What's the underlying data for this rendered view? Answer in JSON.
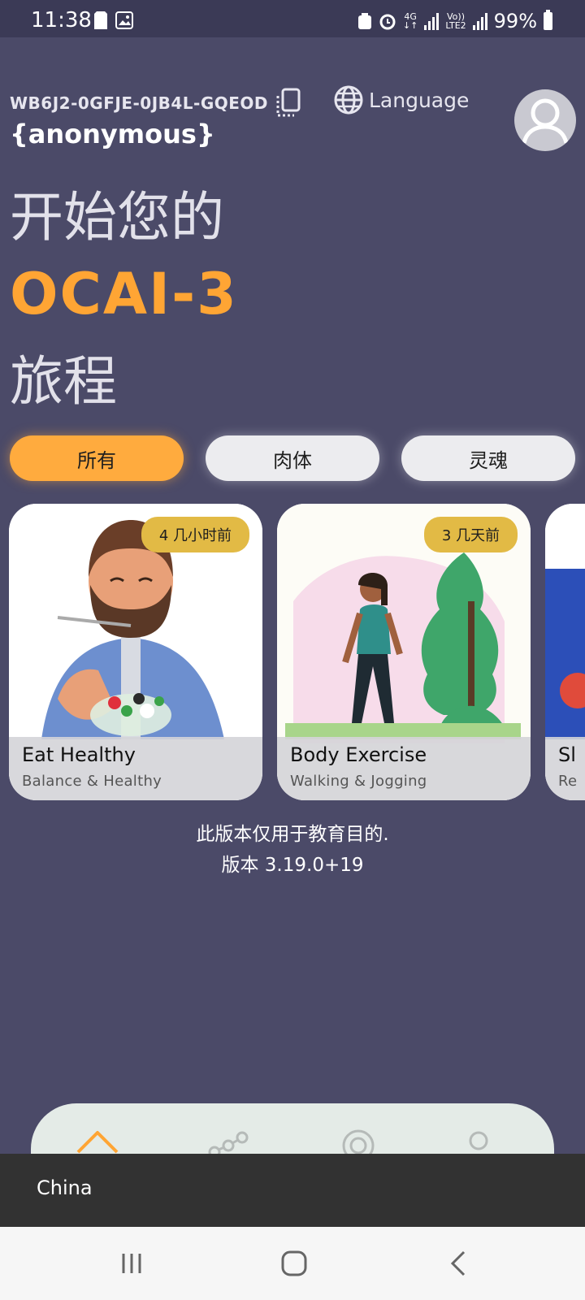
{
  "status_bar": {
    "time": "11:38",
    "network": "4G",
    "volte_top": "Vo))",
    "volte_bottom": "LTE2",
    "battery": "99%"
  },
  "header": {
    "user_code": "WB6J2-0GFJE-0JB4L-GQEOD",
    "language_label": "Language",
    "username": "{anonymous}"
  },
  "hero": {
    "line1": "开始您的",
    "brand": "OCAI-3",
    "line3": "旅程"
  },
  "filters": [
    {
      "label": "所有",
      "active": true
    },
    {
      "label": "肉体",
      "active": false
    },
    {
      "label": "灵魂",
      "active": false
    }
  ],
  "cards": [
    {
      "title": "Eat Healthy",
      "subtitle": "Balance & Healthy",
      "badge": "4 几小时前"
    },
    {
      "title": "Body Exercise",
      "subtitle": "Walking & Jogging",
      "badge": "3 几天前"
    },
    {
      "title": "Sl",
      "subtitle": "Re",
      "badge": ""
    }
  ],
  "footer_note": {
    "line1": "此版本仅用于教育目的.",
    "line2": "版本 3.19.0+19"
  },
  "snackbar": {
    "text": "China"
  },
  "colors": {
    "background": "#4b4a68",
    "accent": "#ffa534",
    "badge": "#e2ba45",
    "chip_inactive": "#ececef"
  },
  "icons": [
    "copy-icon",
    "globe-icon",
    "avatar-icon",
    "home-icon",
    "network-icon",
    "openai-icon",
    "profile-icon",
    "recents-icon",
    "home-nav-icon",
    "back-icon"
  ]
}
